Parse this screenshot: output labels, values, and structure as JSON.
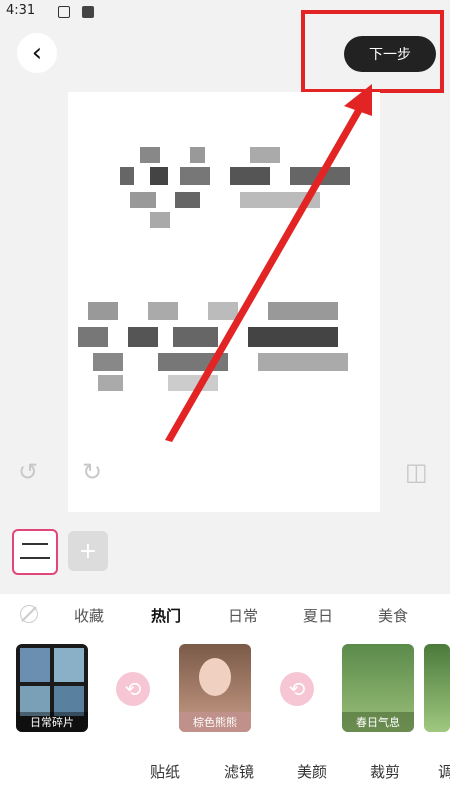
{
  "status_bar": {
    "time": "4:31"
  },
  "header": {
    "back_glyph": "‹",
    "next_label": "下一步"
  },
  "editor": {
    "undo_glyph": "↺",
    "redo_glyph": "↻",
    "compare_glyph": "◫",
    "add_glyph": "+"
  },
  "categories": {
    "items": [
      "收藏",
      "热门",
      "日常",
      "夏日",
      "美食"
    ],
    "active": "热门"
  },
  "stickers": [
    {
      "caption": "日常碎片"
    },
    {
      "caption": "棕色熊熊"
    },
    {
      "caption": "春日气息"
    }
  ],
  "bottom_tabs": [
    "贴纸",
    "滤镜",
    "美颜",
    "裁剪",
    "调"
  ],
  "colors": {
    "accent": "#e0457b",
    "highlight_box": "#e32424",
    "button": "#222222"
  }
}
